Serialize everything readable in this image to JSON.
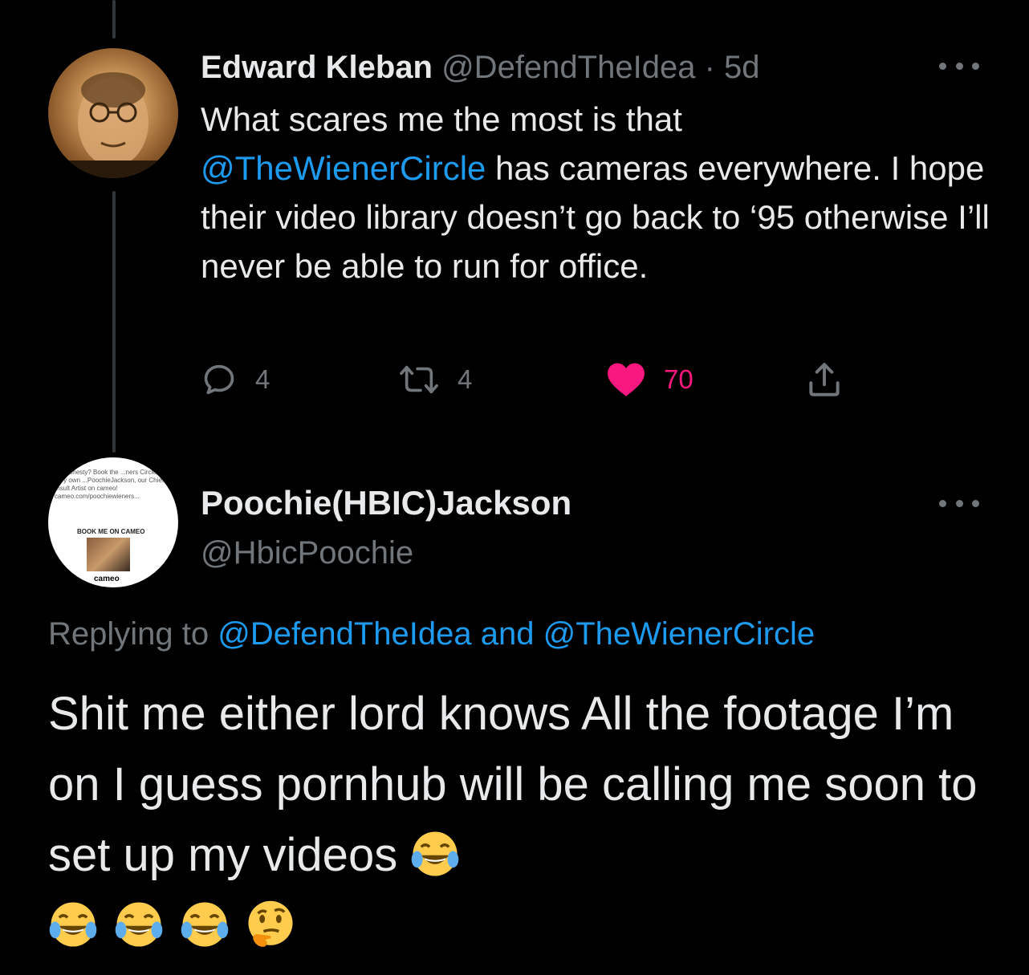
{
  "tweet1": {
    "author_name": "Edward Kleban",
    "handle": "@DefendTheIdea",
    "separator": "·",
    "age": "5d",
    "body_line1": "What scares me the most is that",
    "mention": "@TheWienerCircle",
    "body_rest": " has cameras everywhere. I hope their video library doesn’t go back to ‘95 otherwise I’ll never be able to run for office.",
    "reply_count": "4",
    "retweet_count": "4",
    "like_count": "70",
    "avatar_icon": "profile-photo",
    "colors": {
      "like": "#f91880",
      "link": "#1d9bf0",
      "muted": "#71767b"
    }
  },
  "tweet2": {
    "author_name": "Poochie(HBIC)Jackson",
    "handle": "@HbicPoochie",
    "replying_prefix": "Replying to",
    "replying_to_1": "@DefendTheIdea",
    "replying_and": "and",
    "replying_to_2": "@TheWienerCircle",
    "body": "Shit me either lord knows All the footage I’m on I guess pornhub will be calling me soon to set up my videos",
    "avatar_text": "...d honesty? Book the ...ners Circles very own ...PoochieJackson, our Chief Insult Artist on cameo! cameo.com/poochiewieners...",
    "avatar_banner": "BOOK ME ON CAMEO",
    "avatar_logo": "cameo",
    "emojis": [
      "face-with-tears-of-joy",
      "face-with-tears-of-joy",
      "face-with-tears-of-joy",
      "face-with-tears-of-joy",
      "thinking-face"
    ]
  }
}
